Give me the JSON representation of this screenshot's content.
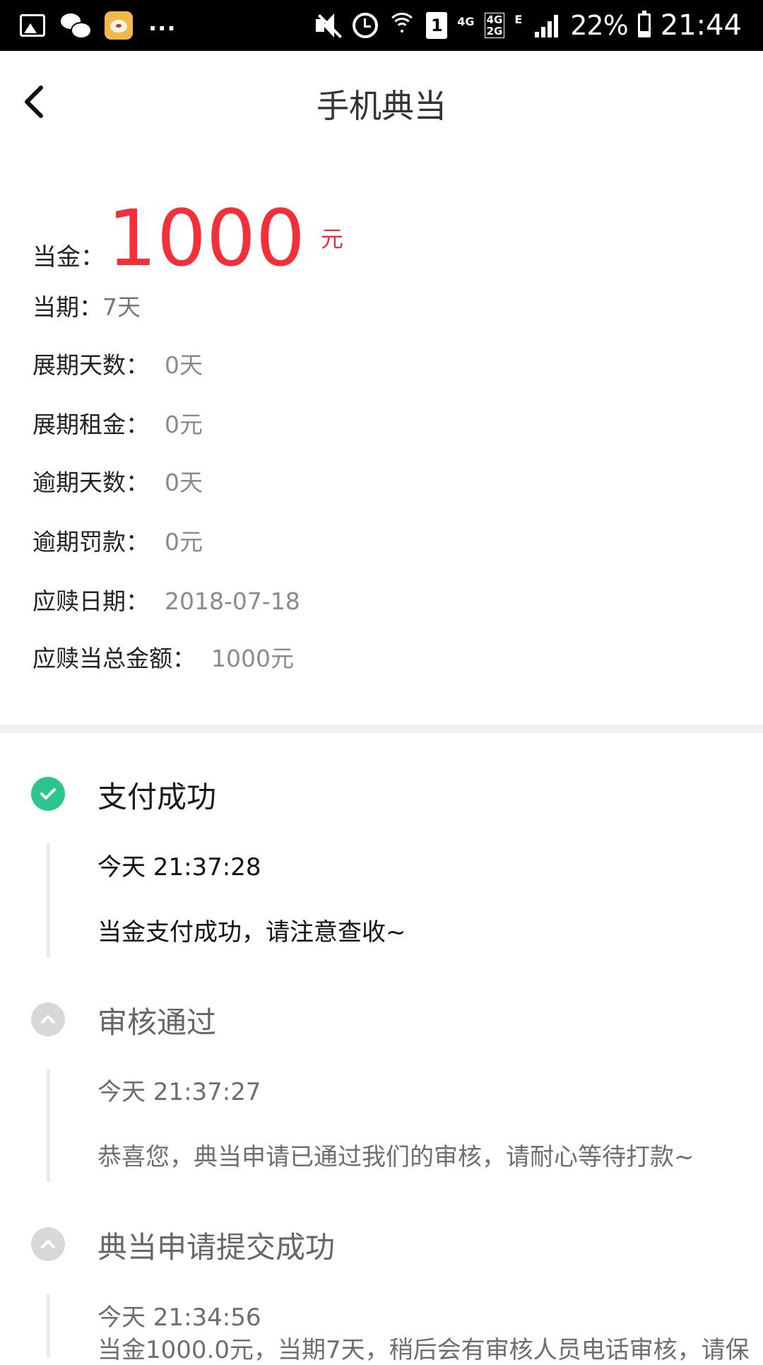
{
  "status_bar": {
    "icons_left": [
      "gallery-icon",
      "wechat-icon",
      "app-tiger-icon"
    ],
    "more": "...",
    "sim_slot": "1",
    "net_top": "4G",
    "net_combo_top": "4G",
    "net_combo_bottom": "2G",
    "net_e": "E",
    "battery_percent": "22%",
    "time": "21:44"
  },
  "nav": {
    "title": "手机典当",
    "back_icon": "chevron-left-icon"
  },
  "summary": {
    "amount_label": "当金：",
    "amount_value": "1000",
    "amount_unit": "元",
    "term_label": "当期：",
    "term_value": "7天",
    "details": [
      {
        "label": "展期天数：",
        "value": "0天"
      },
      {
        "label": "展期租金：",
        "value": "0元"
      },
      {
        "label": "逾期天数：",
        "value": "0天"
      },
      {
        "label": "逾期罚款：",
        "value": "0元"
      },
      {
        "label": "应赎日期：",
        "value": "2018-07-18"
      },
      {
        "label": "应赎当总金额：",
        "value": "1000元"
      }
    ]
  },
  "timeline": [
    {
      "title": "支付成功",
      "status": "done",
      "time": "今天 21:37:28",
      "desc": "当金支付成功，请注意查收~"
    },
    {
      "title": "审核通过",
      "status": "pending",
      "time": "今天 21:37:27",
      "desc": "恭喜您，典当申请已通过我们的审核，请耐心等待打款~"
    },
    {
      "title": "典当申请提交成功",
      "status": "pending",
      "time": "今天 21:34:56",
      "desc": "当金1000.0元，当期7天，稍后会有审核人员电话审核，请保"
    }
  ],
  "colors": {
    "accent_red": "#f2303a",
    "success_green": "#2ec58a",
    "pending_gray": "#d8d8d8"
  }
}
